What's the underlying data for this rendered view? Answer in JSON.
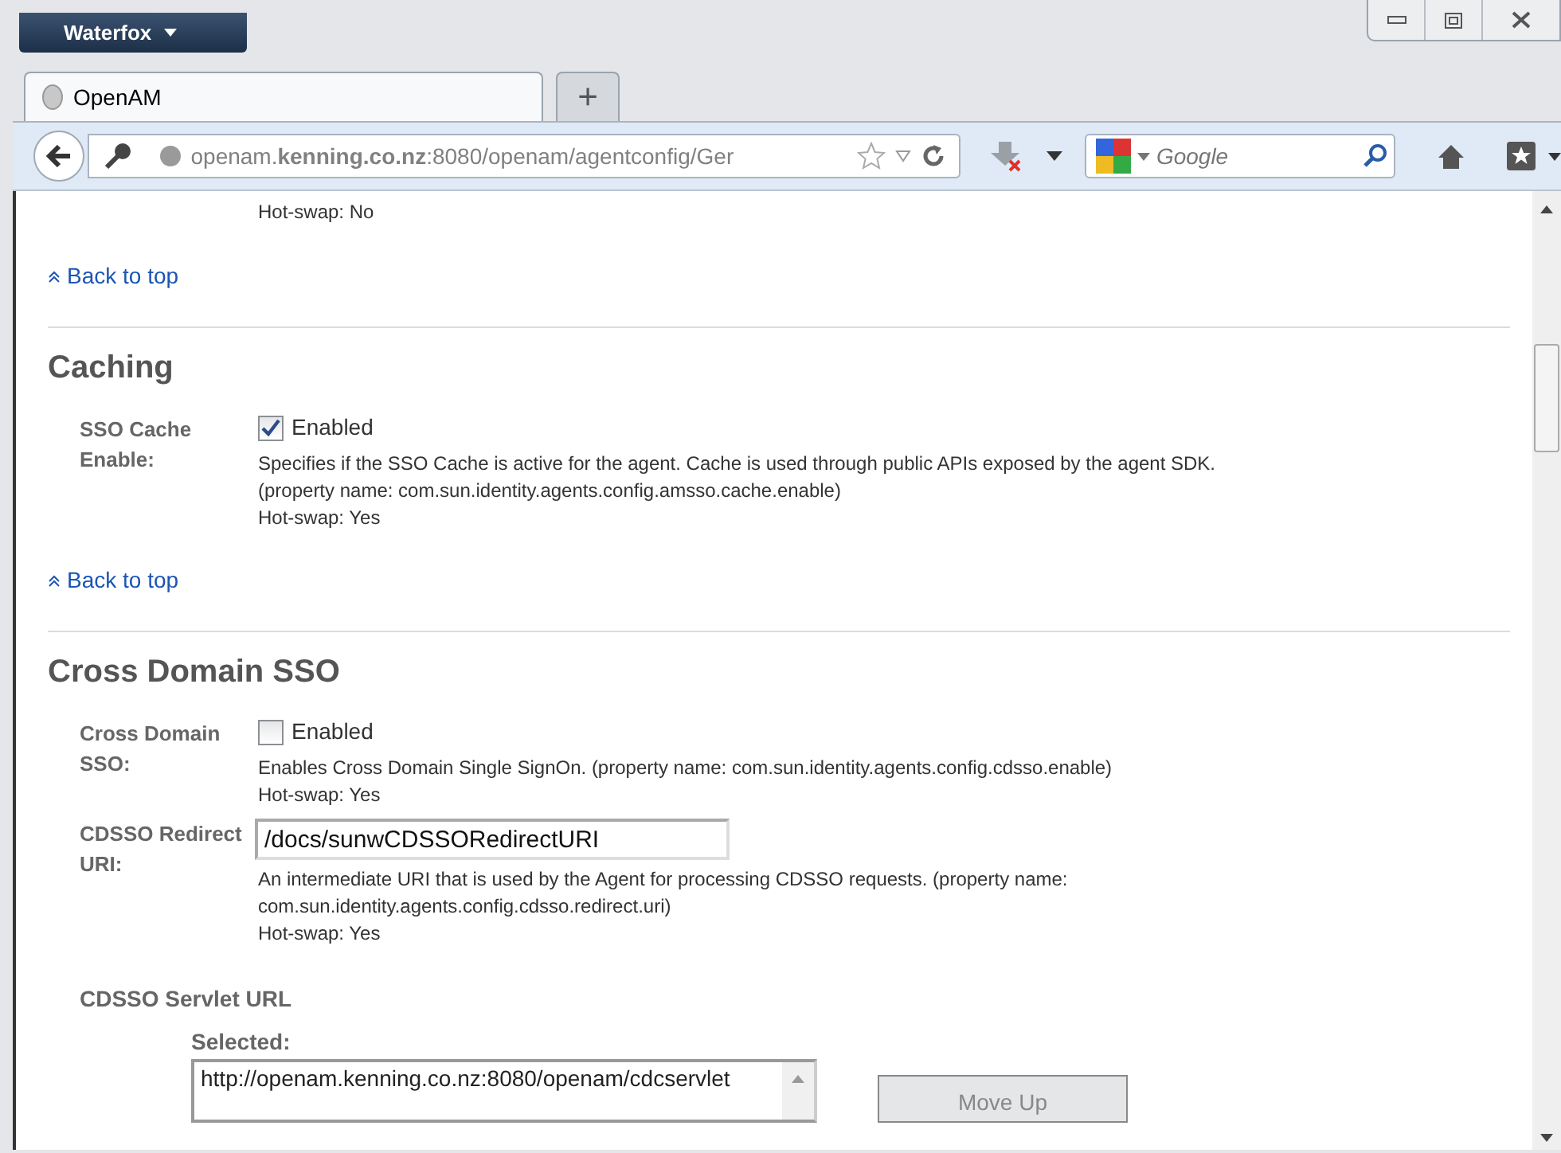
{
  "browser": {
    "menu_button": "Waterfox",
    "tabs": [
      {
        "label": "OpenAM",
        "selected": true
      }
    ],
    "new_tab": "+",
    "address": "openam.**kenning.co.nz**:8080/openam/agentconfig/Ger",
    "search": {
      "placeholder": "Google"
    }
  },
  "page": {
    "top_hot_swap": "Hot-swap: No",
    "top_back_link": "Back to top",
    "sections": [
      {
        "title": "Caching",
        "back_link": "Back to top",
        "properties": [
          {
            "kind": "checkbox",
            "label": "SSO Cache Enable:",
            "option": "Enabled",
            "checked": true,
            "description": "Specifies if the SSO Cache is active for the agent. Cache is used through public APIs exposed by the agent SDK.\n(property name: com.sun.identity.agents.config.amsso.cache.enable)",
            "hot_swap": "Hot-swap: Yes"
          }
        ]
      },
      {
        "title": "Cross Domain SSO",
        "properties": [
          {
            "kind": "checkbox",
            "label": "Cross Domain SSO:",
            "option": "Enabled",
            "checked": false,
            "description": "Enables Cross Domain Single SignOn. (property name: com.sun.identity.agents.config.cdsso.enable)",
            "hot_swap": "Hot-swap: Yes"
          },
          {
            "kind": "text",
            "label": "CDSSO Redirect URI:",
            "value": "/docs/sunwCDSSORedirectURI",
            "description": "An intermediate URI that is used by the Agent for processing CDSSO requests. (property name:\ncom.sun.identity.agents.config.cdsso.redirect.uri)",
            "hot_swap": "Hot-swap: Yes"
          },
          {
            "kind": "list",
            "label": "CDSSO Servlet URL",
            "list_label": "Selected:",
            "items": [
              "http://openam.kenning.co.nz:8080/openam/cdcservlet"
            ],
            "button": "Move Up"
          }
        ]
      }
    ]
  }
}
